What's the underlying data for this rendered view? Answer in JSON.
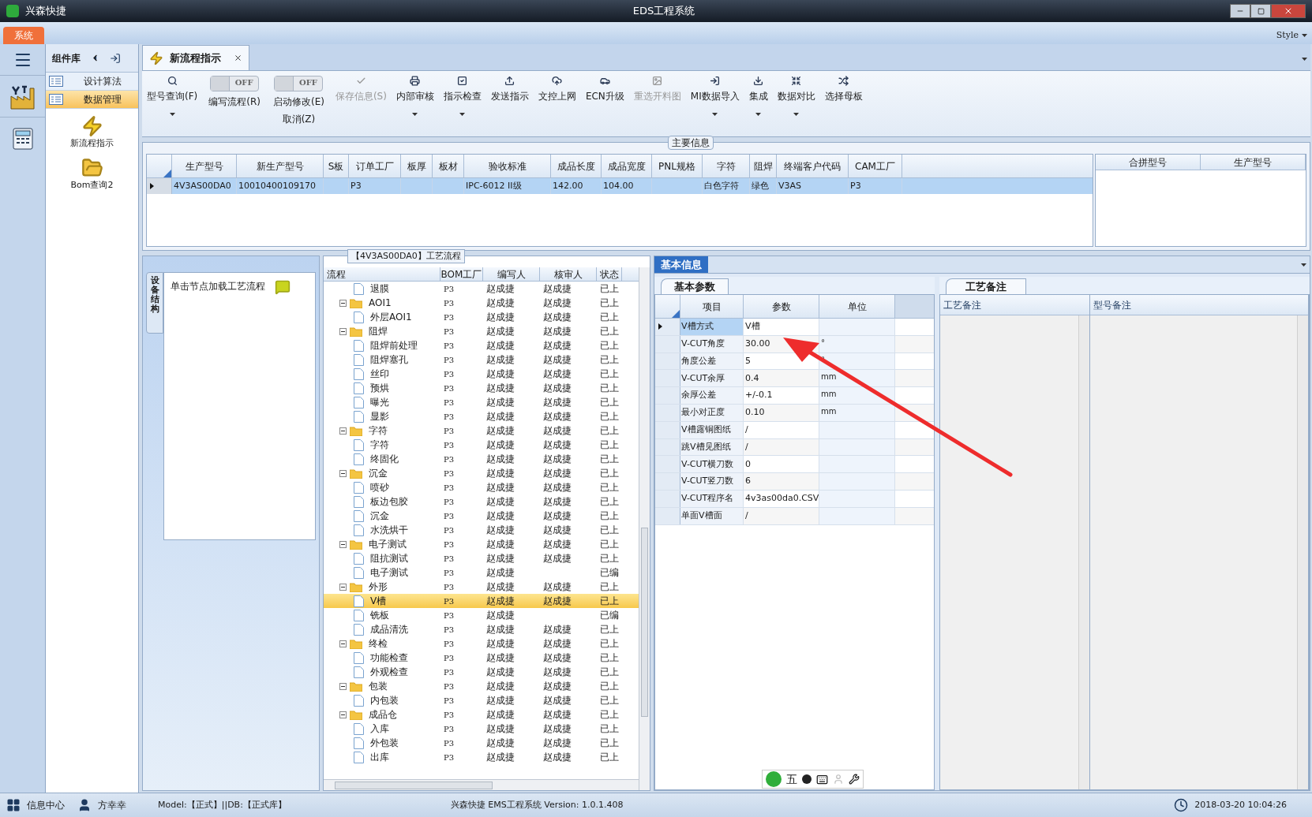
{
  "title_bar": {
    "app": "兴森快捷",
    "title": "EDS工程系统"
  },
  "ribbon": {
    "tabs": [
      {
        "label": "系统",
        "selected": true
      }
    ],
    "style_menu": "Style"
  },
  "side_panel": {
    "title": "组件库",
    "items": [
      {
        "label": "设计算法",
        "selected": false
      },
      {
        "label": "数据管理",
        "selected": true
      }
    ],
    "tools": [
      {
        "label": "新流程指示",
        "kind": "bolt"
      },
      {
        "label": "Bom查询2",
        "kind": "folder"
      }
    ]
  },
  "doc_tabs": [
    {
      "label": "新流程指示",
      "selected": true
    }
  ],
  "toolbar": [
    {
      "kind": "button",
      "label": "型号查询(F)",
      "dropdown": true,
      "disabled": false
    },
    {
      "kind": "toggle",
      "label": "编写流程(R)",
      "switch_text": "OFF",
      "on": false
    },
    {
      "kind": "toggle",
      "label": "启动修改(E)",
      "sublabel": "取消(Z)",
      "switch_text": "OFF",
      "on": false
    },
    {
      "kind": "button",
      "label": "保存信息(S)",
      "dropdown": false,
      "disabled": true
    },
    {
      "kind": "button",
      "label": "内部审核",
      "dropdown": true,
      "disabled": false
    },
    {
      "kind": "button",
      "label": "指示检查",
      "dropdown": true,
      "disabled": false
    },
    {
      "kind": "button",
      "label": "发送指示",
      "dropdown": false,
      "disabled": false
    },
    {
      "kind": "button",
      "label": "文控上网",
      "dropdown": false,
      "disabled": false
    },
    {
      "kind": "button",
      "label": "ECN升级",
      "dropdown": false,
      "disabled": false
    },
    {
      "kind": "button",
      "label": "重选开料图",
      "dropdown": false,
      "disabled": true
    },
    {
      "kind": "button",
      "label": "MI数据导入",
      "dropdown": true,
      "disabled": false
    },
    {
      "kind": "button",
      "label": "集成",
      "dropdown": true,
      "disabled": false
    },
    {
      "kind": "button",
      "label": "数据对比",
      "dropdown": true,
      "disabled": false
    },
    {
      "kind": "button",
      "label": "选择母板",
      "dropdown": false,
      "disabled": false
    }
  ],
  "main_info": {
    "title": "主要信息",
    "columns": [
      "生产型号",
      "新生产型号",
      "S板",
      "订单工厂",
      "板厚",
      "板材",
      "验收标准",
      "成品长度",
      "成品宽度",
      "PNL规格",
      "字符",
      "阻焊",
      "终端客户代码",
      "CAM工厂"
    ],
    "rows": [
      {
        "cells": [
          "4V3AS00DA0",
          "10010400109170",
          "",
          "P3",
          "",
          "",
          "IPC-6012 II级",
          "142.00",
          "104.00",
          "",
          "白色字符",
          "绿色",
          "V3AS",
          "P3"
        ],
        "selected": true
      }
    ],
    "side_columns": [
      "合拼型号",
      "生产型号"
    ]
  },
  "process": {
    "vertical_tab": "设备结构",
    "hint": "单击节点加载工艺流程",
    "caption": "【4V3AS00DA0】工艺流程",
    "columns": [
      "流程",
      "BOM工厂",
      "编写人",
      "核审人",
      "状态"
    ],
    "rows": [
      {
        "name": "退膜",
        "bom": "P3",
        "writer": "赵成捷",
        "reviewer": "赵成捷",
        "status": "已上",
        "selected": false
      },
      {
        "name": "AOI1",
        "bom": "P3",
        "writer": "赵成捷",
        "reviewer": "赵成捷",
        "status": "已上",
        "selected": false,
        "expanded": true,
        "children": [
          {
            "name": "外层AOI1",
            "bom": "P3",
            "writer": "赵成捷",
            "reviewer": "赵成捷",
            "status": "已上",
            "selected": false
          }
        ]
      },
      {
        "name": "阻焊",
        "bom": "P3",
        "writer": "赵成捷",
        "reviewer": "赵成捷",
        "status": "已上",
        "selected": false,
        "expanded": true,
        "children": [
          {
            "name": "阻焊前处理",
            "bom": "P3",
            "writer": "赵成捷",
            "reviewer": "赵成捷",
            "status": "已上",
            "selected": false
          },
          {
            "name": "阻焊塞孔",
            "bom": "P3",
            "writer": "赵成捷",
            "reviewer": "赵成捷",
            "status": "已上",
            "selected": false
          },
          {
            "name": "丝印",
            "bom": "P3",
            "writer": "赵成捷",
            "reviewer": "赵成捷",
            "status": "已上",
            "selected": false
          },
          {
            "name": "预烘",
            "bom": "P3",
            "writer": "赵成捷",
            "reviewer": "赵成捷",
            "status": "已上",
            "selected": false
          },
          {
            "name": "曝光",
            "bom": "P3",
            "writer": "赵成捷",
            "reviewer": "赵成捷",
            "status": "已上",
            "selected": false
          },
          {
            "name": "显影",
            "bom": "P3",
            "writer": "赵成捷",
            "reviewer": "赵成捷",
            "status": "已上",
            "selected": false
          }
        ]
      },
      {
        "name": "字符",
        "bom": "P3",
        "writer": "赵成捷",
        "reviewer": "赵成捷",
        "status": "已上",
        "selected": false,
        "expanded": true,
        "children": [
          {
            "name": "字符",
            "bom": "P3",
            "writer": "赵成捷",
            "reviewer": "赵成捷",
            "status": "已上",
            "selected": false
          },
          {
            "name": "终固化",
            "bom": "P3",
            "writer": "赵成捷",
            "reviewer": "赵成捷",
            "status": "已上",
            "selected": false
          }
        ]
      },
      {
        "name": "沉金",
        "bom": "P3",
        "writer": "赵成捷",
        "reviewer": "赵成捷",
        "status": "已上",
        "selected": false,
        "expanded": true,
        "children": [
          {
            "name": "喷砂",
            "bom": "P3",
            "writer": "赵成捷",
            "reviewer": "赵成捷",
            "status": "已上",
            "selected": false
          },
          {
            "name": "板边包胶",
            "bom": "P3",
            "writer": "赵成捷",
            "reviewer": "赵成捷",
            "status": "已上",
            "selected": false
          },
          {
            "name": "沉金",
            "bom": "P3",
            "writer": "赵成捷",
            "reviewer": "赵成捷",
            "status": "已上",
            "selected": false
          },
          {
            "name": "水洗烘干",
            "bom": "P3",
            "writer": "赵成捷",
            "reviewer": "赵成捷",
            "status": "已上",
            "selected": false
          }
        ]
      },
      {
        "name": "电子测试",
        "bom": "P3",
        "writer": "赵成捷",
        "reviewer": "赵成捷",
        "status": "已上",
        "selected": false,
        "expanded": true,
        "children": [
          {
            "name": "阻抗测试",
            "bom": "P3",
            "writer": "赵成捷",
            "reviewer": "赵成捷",
            "status": "已上",
            "selected": false
          },
          {
            "name": "电子测试",
            "bom": "P3",
            "writer": "赵成捷",
            "status": "已编",
            "selected": false
          }
        ]
      },
      {
        "name": "外形",
        "bom": "P3",
        "writer": "赵成捷",
        "reviewer": "赵成捷",
        "status": "已上",
        "selected": false,
        "expanded": true,
        "children": [
          {
            "name": "V槽",
            "bom": "P3",
            "writer": "赵成捷",
            "reviewer": "赵成捷",
            "status": "已上",
            "selected": true
          },
          {
            "name": "铣板",
            "bom": "P3",
            "writer": "赵成捷",
            "status": "已编",
            "selected": false
          },
          {
            "name": "成品清洗",
            "bom": "P3",
            "writer": "赵成捷",
            "reviewer": "赵成捷",
            "status": "已上",
            "selected": false
          }
        ]
      },
      {
        "name": "终检",
        "bom": "P3",
        "writer": "赵成捷",
        "reviewer": "赵成捷",
        "status": "已上",
        "selected": false,
        "expanded": true,
        "children": [
          {
            "name": "功能检查",
            "bom": "P3",
            "writer": "赵成捷",
            "reviewer": "赵成捷",
            "status": "已上",
            "selected": false
          },
          {
            "name": "外观检查",
            "bom": "P3",
            "writer": "赵成捷",
            "reviewer": "赵成捷",
            "status": "已上",
            "selected": false
          }
        ]
      },
      {
        "name": "包装",
        "bom": "P3",
        "writer": "赵成捷",
        "reviewer": "赵成捷",
        "status": "已上",
        "selected": false,
        "expanded": true,
        "children": [
          {
            "name": "内包装",
            "bom": "P3",
            "writer": "赵成捷",
            "reviewer": "赵成捷",
            "status": "已上",
            "selected": false
          }
        ]
      },
      {
        "name": "成品仓",
        "bom": "P3",
        "writer": "赵成捷",
        "reviewer": "赵成捷",
        "status": "已上",
        "selected": false,
        "expanded": true,
        "children": [
          {
            "name": "入库",
            "bom": "P3",
            "writer": "赵成捷",
            "reviewer": "赵成捷",
            "status": "已上",
            "selected": false
          },
          {
            "name": "外包装",
            "bom": "P3",
            "writer": "赵成捷",
            "reviewer": "赵成捷",
            "status": "已上",
            "selected": false
          },
          {
            "name": "出库",
            "bom": "P3",
            "writer": "赵成捷",
            "reviewer": "赵成捷",
            "status": "已上",
            "selected": false
          }
        ]
      }
    ]
  },
  "basic_info": {
    "tab": "基本信息",
    "params": {
      "tab": "基本参数",
      "columns": [
        "项目",
        "参数",
        "单位"
      ],
      "rows": [
        {
          "item": "V槽方式",
          "value": "V槽",
          "selected": true
        },
        {
          "item": "V-CUT角度",
          "value": "30.00",
          "unit": "°",
          "selected": false
        },
        {
          "item": "角度公差",
          "value": "5",
          "unit": "°",
          "selected": false
        },
        {
          "item": "V-CUT余厚",
          "value": "0.4",
          "unit": "mm",
          "selected": false
        },
        {
          "item": "余厚公差",
          "value": "+/-0.1",
          "unit": "mm",
          "selected": false
        },
        {
          "item": "最小对正度",
          "value": "0.10",
          "unit": "mm",
          "selected": false
        },
        {
          "item": "V槽露铜图纸",
          "value": "/",
          "selected": false
        },
        {
          "item": "跳V槽见图纸",
          "value": "/",
          "selected": false
        },
        {
          "item": "V-CUT横刀数",
          "value": "0",
          "selected": false
        },
        {
          "item": "V-CUT竖刀数",
          "value": "6",
          "selected": false
        },
        {
          "item": "V-CUT程序名",
          "value": "4v3as00da0.CSV",
          "selected": false
        },
        {
          "item": "单面V槽面",
          "value": "/",
          "selected": false
        }
      ]
    },
    "notes": {
      "tab": "工艺备注",
      "columns": [
        "工艺备注",
        "型号备注"
      ]
    }
  },
  "ime_bar": {
    "mode": "五"
  },
  "status_bar": {
    "info_center": "信息中心",
    "user": "方幸幸",
    "model": "Model:【正式】||DB:【正式库】",
    "version": "兴森快捷 EMS工程系统 Version: 1.0.1.408",
    "time": "2018-03-20 10:04:26"
  }
}
